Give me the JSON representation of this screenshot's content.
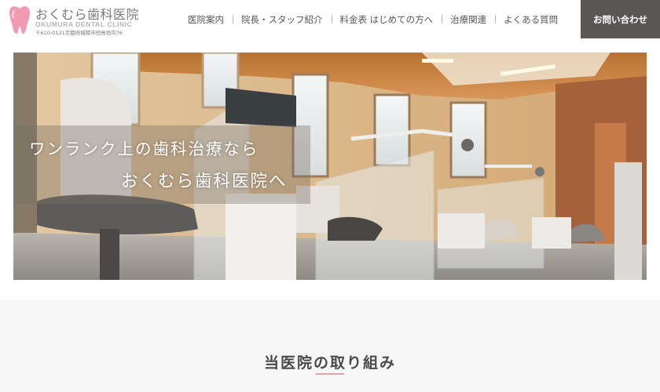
{
  "header": {
    "logo": {
      "name_jp": "おくむら歯科医院",
      "name_en": "OKUMURA DENTAL CLINIC",
      "address": "〒610-0121京都府城陽市田島垣内76"
    },
    "nav": [
      {
        "label": "医院案内"
      },
      {
        "label": "院長・スタッフ紹介"
      },
      {
        "label": "料金表 はじめての方へ"
      },
      {
        "label": "治療関連"
      },
      {
        "label": "よくある質問"
      }
    ],
    "contact_label": "お問い合わせ"
  },
  "hero": {
    "line1": "ワンランク上の歯科治療なら",
    "line2": "おくむら歯科医院へ"
  },
  "section": {
    "title": "当医院の取り組み"
  },
  "colors": {
    "contact_bg": "#595656",
    "tooth_pink": "#f29bb0",
    "underline": "#e0a3a8"
  },
  "icons": [
    "tooth-logo-icon"
  ]
}
